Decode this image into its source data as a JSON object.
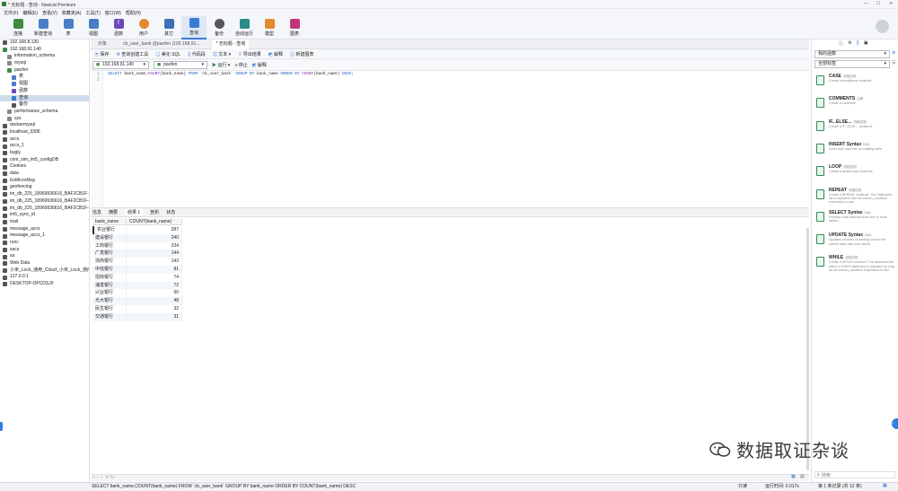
{
  "app": {
    "title": "* 无标题 - 查询 - Navicat Premium"
  },
  "menu": [
    "文件(F)",
    "编辑(E)",
    "查看(V)",
    "收藏夹(A)",
    "工具(T)",
    "窗口(W)",
    "帮助(H)"
  ],
  "toolbar": [
    {
      "label": "连接",
      "icon": "connection-icon",
      "color": "#3f8e3f"
    },
    {
      "label": "新建查询",
      "icon": "new-query-icon",
      "color": "#4a7cc7"
    },
    {
      "label": "表",
      "icon": "table-icon",
      "color": "#4a7cc7"
    },
    {
      "label": "视图",
      "icon": "view-icon",
      "color": "#4a7cc7"
    },
    {
      "label": "函数",
      "icon": "function-icon",
      "color": "#6a4ab8"
    },
    {
      "label": "用户",
      "icon": "user-icon",
      "color": "#e08a2b"
    },
    {
      "label": "其它",
      "icon": "tools-icon",
      "color": "#3d6fb8"
    },
    {
      "label": "查询",
      "icon": "query-icon",
      "color": "#3a7bd5"
    },
    {
      "label": "备份",
      "icon": "backup-icon",
      "color": "#555555"
    },
    {
      "label": "自动运行",
      "icon": "automation-icon",
      "color": "#2b8a8a"
    },
    {
      "label": "模型",
      "icon": "model-icon",
      "color": "#e08a2b"
    },
    {
      "label": "图表",
      "icon": "chart-icon",
      "color": "#c0367d"
    }
  ],
  "sidebar": [
    {
      "label": "192.168.8.130",
      "level": 0,
      "color": "#555555"
    },
    {
      "label": "192.168.91.140",
      "level": 0,
      "color": "#3f8e3f"
    },
    {
      "label": "information_schema",
      "level": 1,
      "color": "#888888"
    },
    {
      "label": "mysql",
      "level": 1,
      "color": "#888888"
    },
    {
      "label": "paofen",
      "level": 1,
      "color": "#3f8e3f"
    },
    {
      "label": "表",
      "level": 2,
      "color": "#4a7cc7"
    },
    {
      "label": "视图",
      "level": 2,
      "color": "#4a7cc7"
    },
    {
      "label": "函数",
      "level": 2,
      "color": "#6a4ab8"
    },
    {
      "label": "查询",
      "level": 2,
      "color": "#3a7bd5",
      "selected": true
    },
    {
      "label": "备份",
      "level": 2,
      "color": "#555555"
    },
    {
      "label": "performance_schema",
      "level": 1,
      "color": "#888888"
    },
    {
      "label": "sys",
      "level": 1,
      "color": "#888888"
    },
    {
      "label": "dockermysql",
      "level": 0,
      "color": "#555555"
    },
    {
      "label": "localhost_3306",
      "level": 0,
      "color": "#555555"
    },
    {
      "label": "accs",
      "level": 0,
      "color": "#555555"
    },
    {
      "label": "accs_1",
      "level": 0,
      "color": "#555555"
    },
    {
      "label": "bugly",
      "level": 0,
      "color": "#555555"
    },
    {
      "label": "com_sim_im5_configDB",
      "level": 0,
      "color": "#555555"
    },
    {
      "label": "Cookies",
      "level": 0,
      "color": "#555555"
    },
    {
      "label": "data",
      "level": 0,
      "color": "#555555"
    },
    {
      "label": "EnMicroMsg",
      "level": 0,
      "color": "#555555"
    },
    {
      "label": "geofencing",
      "level": 0,
      "color": "#555555"
    },
    {
      "label": "im_db_225_18969936616_BAF2CB1F-",
      "level": 0,
      "color": "#555555"
    },
    {
      "label": "im_db_225_18969936616_BAF2CB1F-",
      "level": 0,
      "color": "#555555"
    },
    {
      "label": "im_db_225_18969936616_BAF2CB1F-",
      "level": 0,
      "color": "#555555"
    },
    {
      "label": "im5_sync_id",
      "level": 0,
      "color": "#555555"
    },
    {
      "label": "mail",
      "level": 0,
      "color": "#555555"
    },
    {
      "label": "message_accs",
      "level": 0,
      "color": "#555555"
    },
    {
      "label": "message_accs_1",
      "level": 0,
      "color": "#555555"
    },
    {
      "label": "runc",
      "level": 0,
      "color": "#555555"
    },
    {
      "label": "sacs",
      "level": 0,
      "color": "#555555"
    },
    {
      "label": "sa",
      "level": 0,
      "color": "#555555"
    },
    {
      "label": "Web Data",
      "level": 0,
      "color": "#555555"
    },
    {
      "label": "小米_Lock_通用_Cloud_小米_Lock_通用",
      "level": 0,
      "color": "#555555"
    },
    {
      "label": "127.0.0.1",
      "level": 0,
      "color": "#555555"
    },
    {
      "label": "DESKTOP-OPCDSJ0",
      "level": 0,
      "color": "#555555"
    }
  ],
  "tabs": [
    "对象",
    "cb_user_bank @paofen (192.168.91...",
    "* 无标题 - 查询"
  ],
  "query_toolbar": [
    "保存",
    "查询创建工具",
    "美化 SQL",
    "代码段",
    "文本",
    "导出结果",
    "解释",
    "新建图表"
  ],
  "connection": {
    "server": "192.168.91.140",
    "database": "paofen",
    "run": "运行",
    "stop": "停止",
    "explain": "解释"
  },
  "sql": {
    "select": "SELECT",
    "cols": " bank_name,",
    "fn1": "COUNT",
    "arg1": "(bank_name) ",
    "from": "FROM",
    "tbl": " `cb_user_bank` ",
    "group": "GROUP BY",
    "gcol": " bank_name ",
    "order": "ORDER BY",
    "fn2": " COUNT",
    "arg2": "(bank_name) ",
    "desc": "DESC",
    "end": ";"
  },
  "result_tabs": [
    "信息",
    "摘要",
    "结果 1",
    "剖析",
    "状态"
  ],
  "grid": {
    "headers": [
      "bank_name",
      "COUNT(bank_name)"
    ],
    "rows": [
      [
        "农业银行",
        "287"
      ],
      [
        "建设银行",
        "240"
      ],
      [
        "工商银行",
        "234"
      ],
      [
        "广发银行",
        "144"
      ],
      [
        "浙商银行",
        "143"
      ],
      [
        "中信银行",
        "81"
      ],
      [
        "招商银行",
        "74"
      ],
      [
        "浦发银行",
        "72"
      ],
      [
        "兴业银行",
        "60"
      ],
      [
        "光大银行",
        "48"
      ],
      [
        "民生银行",
        "32"
      ],
      [
        "交通银行",
        "31"
      ]
    ]
  },
  "status": {
    "sql": "SELECT bank_name,COUNT(bank_name) FROM `cb_user_bank` GROUP BY bank_name ORDER BY COUNT(bank_name) DESC",
    "mode": "只读",
    "time": "运行时间: 0.017s",
    "records": "第 1 条记录 (共 12 条)"
  },
  "right_panel": {
    "select1": "我的函数",
    "select2": "全部标签",
    "search": "搜索",
    "snippets": [
      {
        "title": "CASE",
        "tag": "流程控制",
        "desc": "Create a conditional construct."
      },
      {
        "title": "COMMENTS",
        "tag": "注释",
        "desc": "Create a comment."
      },
      {
        "title": "IF...ELSE...",
        "tag": "流程控制",
        "desc": "Create a IF...ELSE... construct."
      },
      {
        "title": "INSERT Syntax",
        "tag": "DML",
        "desc": "Insert new rows into an existing table."
      },
      {
        "title": "LOOP",
        "tag": "流程控制",
        "desc": "Create a simple loop construct."
      },
      {
        "title": "REPEAT",
        "tag": "流程控制",
        "desc": "Create a REPEAT construct. The Statement list is repeated until the search_condition expression is true."
      },
      {
        "title": "SELECT Syntax",
        "tag": "DML",
        "desc": "Retrieve rows selected from one or more tables."
      },
      {
        "title": "UPDATE Syntax",
        "tag": "DML",
        "desc": "Updates columns of existing rows in the named table with new values."
      },
      {
        "title": "WHILE",
        "tag": "流程控制",
        "desc": "Create a WHILE construct. The statement list within a WHILE statement is repeated as long as the search_condition expression is true."
      }
    ]
  },
  "watermark": "数据取证杂谈"
}
